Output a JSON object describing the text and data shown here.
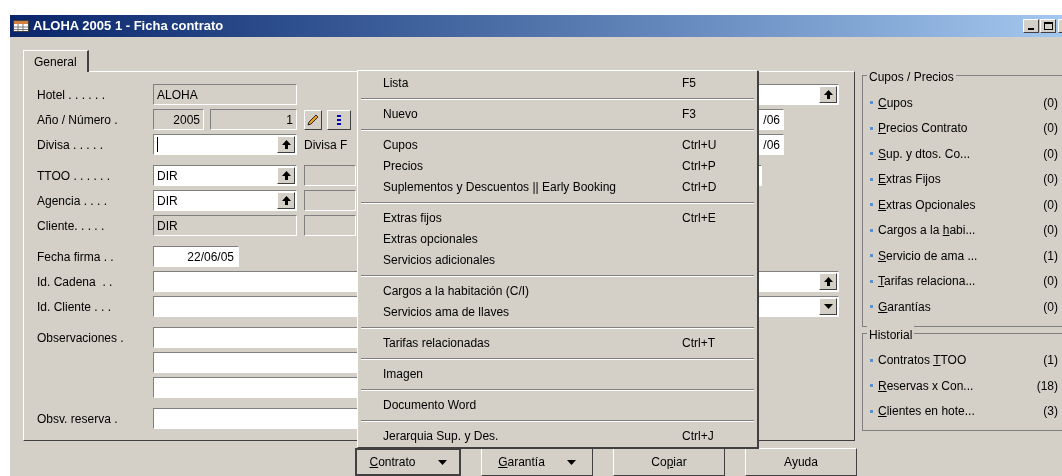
{
  "window": {
    "title": "ALOHA 2005 1 - Ficha contrato"
  },
  "tabs": [
    {
      "label": "General",
      "selected": true
    }
  ],
  "form": {
    "sections": [
      [
        {
          "label": "Hotel . . . . . .",
          "fields": [
            {
              "kind": "readonly",
              "value": "ALOHA"
            }
          ],
          "side": {
            "kind": "dropdown"
          }
        },
        {
          "label": "Año / Número .",
          "fields": [
            {
              "kind": "year",
              "value": "2005"
            },
            {
              "kind": "number",
              "value": "1"
            },
            {
              "kind": "edit-button"
            },
            {
              "kind": "list-button"
            }
          ],
          "side": {
            "kind": "date",
            "value": "/06"
          }
        },
        {
          "label": "Divisa . . . . .",
          "fields": [
            {
              "kind": "dropdown",
              "focused": true
            },
            {
              "kind": "caption",
              "value": "Divisa F"
            }
          ],
          "side": {
            "kind": "date",
            "value": "/06"
          }
        }
      ],
      [
        {
          "label": "TTOO . . . . . .",
          "fields": [
            {
              "kind": "dropdown",
              "value": "DIR"
            },
            {
              "kind": "readonly"
            }
          ],
          "side": {
            "kind": "small"
          }
        },
        {
          "label": "Agencia . . . .",
          "fields": [
            {
              "kind": "dropdown",
              "value": "DIR"
            },
            {
              "kind": "readonly"
            }
          ]
        },
        {
          "label": "Cliente. . . . .",
          "fields": [
            {
              "kind": "readonly",
              "value": "DIR"
            },
            {
              "kind": "readonly"
            }
          ]
        }
      ],
      [
        {
          "label": "Fecha firma . .",
          "fields": [
            {
              "kind": "date",
              "value": "22/06/05"
            }
          ]
        },
        {
          "label": "Id. Cadena  . .",
          "fields": [
            {
              "kind": "wide-lookup"
            }
          ]
        },
        {
          "label": "Id. Cliente . . .",
          "fields": [
            {
              "kind": "wide-select"
            }
          ]
        }
      ],
      [
        {
          "label": "Observaciones .",
          "fields": [
            {
              "kind": "wide"
            }
          ]
        },
        {
          "fields": [
            {
              "kind": "wide"
            }
          ]
        },
        {
          "fields": [
            {
              "kind": "wide"
            }
          ]
        }
      ],
      [
        {
          "label": "Obsv. reserva .",
          "fields": [
            {
              "kind": "wide"
            }
          ]
        }
      ]
    ]
  },
  "menu": {
    "groups": [
      [
        {
          "label": "Lista",
          "shortcut": "F5"
        }
      ],
      [
        {
          "label": "Nuevo",
          "shortcut": "F3"
        }
      ],
      [
        {
          "label": "Cupos",
          "shortcut": "Ctrl+U"
        },
        {
          "label": "Precios",
          "shortcut": "Ctrl+P"
        },
        {
          "label": "Suplementos y Descuentos || Early Booking",
          "shortcut": "Ctrl+D"
        }
      ],
      [
        {
          "label": "Extras fijos",
          "shortcut": "Ctrl+E"
        },
        {
          "label": "Extras opcionales"
        },
        {
          "label": "Servicios adicionales"
        }
      ],
      [
        {
          "label": "Cargos a la habitación (C/I)"
        },
        {
          "label": "Servicios ama de llaves"
        }
      ],
      [
        {
          "label": "Tarifas relacionadas",
          "shortcut": "Ctrl+T"
        }
      ],
      [
        {
          "label": "Imagen"
        }
      ],
      [
        {
          "label": "Documento Word"
        }
      ],
      [
        {
          "label": "Jerarquia Sup. y Des.",
          "shortcut": "Ctrl+J"
        }
      ]
    ]
  },
  "buttons": [
    {
      "key": "C",
      "post": "ontrato",
      "dropdown": true,
      "pressed": true
    },
    {
      "key": "G",
      "post": "arantía",
      "dropdown": true,
      "pressed": false
    },
    {
      "pre": "Co",
      "key": "p",
      "post": "iar",
      "dropdown": false,
      "pressed": false
    },
    {
      "pre": "Ayuda",
      "dropdown": false,
      "pressed": false
    }
  ],
  "side_panel": [
    {
      "title": "Cupos / Precios",
      "links": [
        {
          "key": "C",
          "post": "upos",
          "count": "(0)"
        },
        {
          "key": "P",
          "post": "recios Contrato",
          "count": "(0)"
        },
        {
          "key": "S",
          "post": "up. y dtos. Co...",
          "count": "(0)"
        },
        {
          "key": "E",
          "post": "xtras Fijos",
          "count": "(0)"
        },
        {
          "key": "E",
          "post": "xtras Opcionales",
          "count": "(0)"
        },
        {
          "pre": "Cargos a la ",
          "key": "h",
          "post": "abi...",
          "count": "(0)"
        },
        {
          "key": "S",
          "post": "ervicio de ama ...",
          "count": "(1)"
        },
        {
          "key": "T",
          "post": "arifas relaciona...",
          "count": "(0)"
        },
        {
          "key": "G",
          "post": "arantías",
          "count": "(0)"
        }
      ]
    },
    {
      "title": "Historial",
      "links": [
        {
          "pre": "Contratos ",
          "key": "T",
          "post": "TOO",
          "count": "(1)"
        },
        {
          "key": "R",
          "post": "eservas x Con...",
          "count": "(18)"
        },
        {
          "key": "C",
          "post": "lientes en hote...",
          "count": "(3)"
        }
      ]
    }
  ]
}
